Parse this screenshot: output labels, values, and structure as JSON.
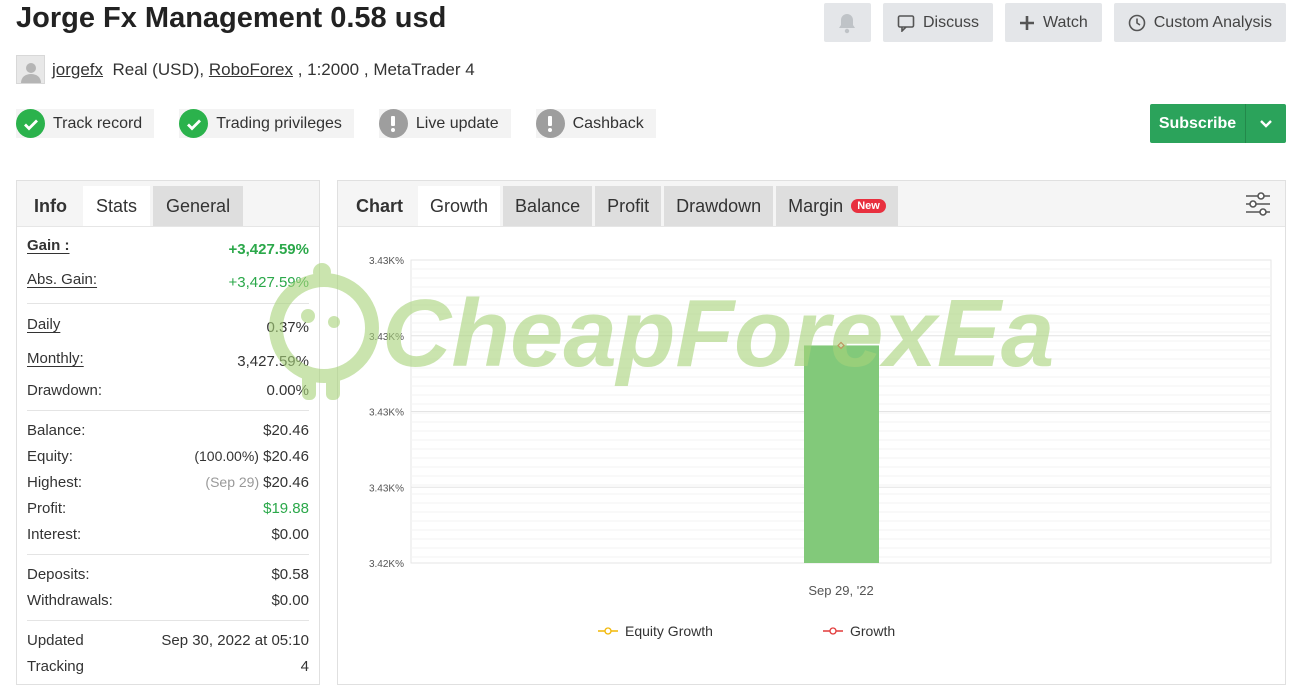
{
  "title": "Jorge Fx Management 0.58 usd",
  "actions": {
    "bell_icon": "bell-icon",
    "discuss": "Discuss",
    "watch": "Watch",
    "custom_analysis": "Custom Analysis"
  },
  "account": {
    "user": "jorgefx",
    "type": "Real (USD),",
    "broker": "RoboForex",
    "leverage": ", 1:2000 ,",
    "platform": "MetaTrader 4"
  },
  "badges": [
    {
      "label": "Track record",
      "status": "ok"
    },
    {
      "label": "Trading privileges",
      "status": "ok"
    },
    {
      "label": "Live update",
      "status": "warn"
    },
    {
      "label": "Cashback",
      "status": "warn"
    }
  ],
  "subscribe": "Subscribe",
  "left_tabs": [
    "Info",
    "Stats",
    "General"
  ],
  "stats": {
    "gain": {
      "label": "Gain :",
      "value": "+3,427.59%"
    },
    "abs_gain": {
      "label": "Abs. Gain:",
      "value": "+3,427.59%"
    },
    "daily": {
      "label": "Daily",
      "value": "0.37%"
    },
    "monthly": {
      "label": "Monthly:",
      "value": "3,427.59%"
    },
    "drawdown": {
      "label": "Drawdown:",
      "value": "0.00%"
    },
    "balance": {
      "label": "Balance:",
      "value": "$20.46"
    },
    "equity": {
      "label": "Equity:",
      "note": "(100.00%)",
      "value": "$20.46"
    },
    "highest": {
      "label": "Highest:",
      "note": "(Sep 29)",
      "value": "$20.46"
    },
    "profit": {
      "label": "Profit:",
      "value": "$19.88"
    },
    "interest": {
      "label": "Interest:",
      "value": "$0.00"
    },
    "deposits": {
      "label": "Deposits:",
      "value": "$0.58"
    },
    "withdrawals": {
      "label": "Withdrawals:",
      "value": "$0.00"
    },
    "updated": {
      "label": "Updated",
      "value": "Sep 30, 2022 at 05:10"
    },
    "tracking": {
      "label": "Tracking",
      "value": "4"
    }
  },
  "chart_tabs": {
    "chart": "Chart",
    "growth": "Growth",
    "balance": "Balance",
    "profit": "Profit",
    "drawdown": "Drawdown",
    "margin": "Margin",
    "new_badge": "New"
  },
  "watermark": "CheapForexEa",
  "colors": {
    "accent_green": "#2ba35b",
    "bar_green": "#82c97a",
    "growth_red": "#e23a3a",
    "equity_yellow": "#f2b705"
  },
  "chart_data": {
    "type": "bar",
    "categories": [
      "Sep 29, '22"
    ],
    "y_tick_labels": [
      "3.43K%",
      "3.43K%",
      "3.43K%",
      "3.43K%",
      "3.42K%"
    ],
    "series": [
      {
        "name": "Growth",
        "values": [
          3427.59
        ]
      },
      {
        "name": "Equity Growth",
        "values": [
          3427.59
        ]
      }
    ],
    "ylim": [
      3424,
      3429
    ],
    "grid": true,
    "legend": "bottom",
    "legend_entries": [
      "Equity Growth",
      "Growth"
    ]
  }
}
